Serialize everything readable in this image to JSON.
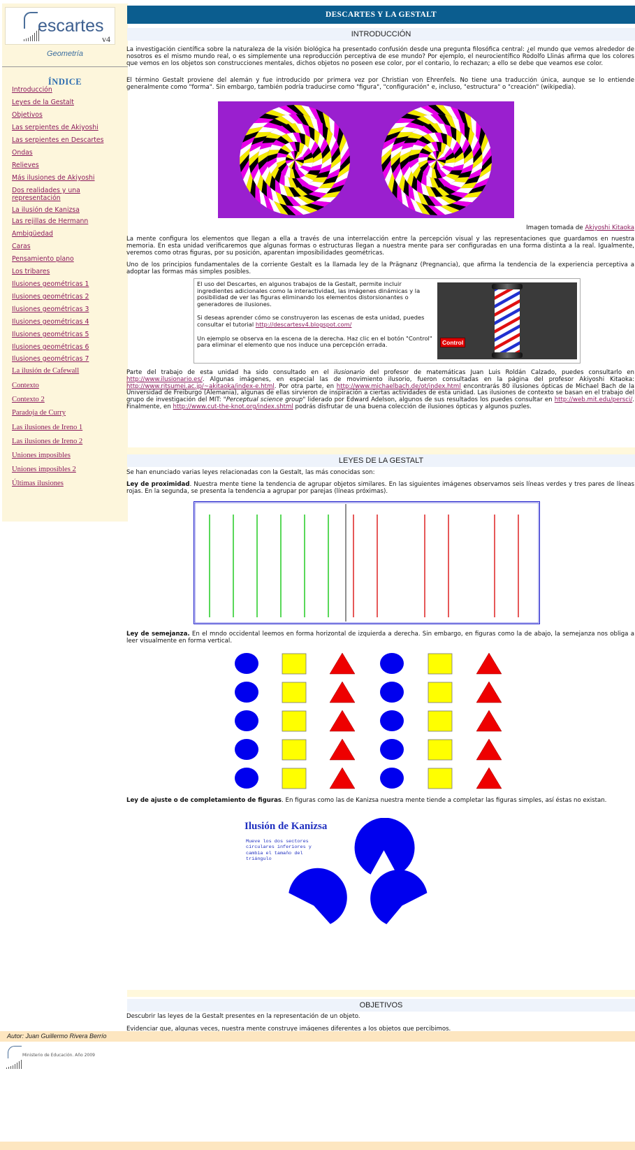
{
  "brand": {
    "logo_text": "escartes",
    "logo_initial": "D",
    "version": "v4",
    "subject": "Geometría"
  },
  "sidebar": {
    "index_title": "ÍNDICE",
    "items": [
      "Introducción",
      "Leyes de la Gestalt",
      "Objetivos",
      "Las serpientes de Akiyoshi",
      "Las serpientes en Descartes",
      "Ondas",
      "Relieves",
      "Más ilusiones de Akiyoshi",
      "Dos realidades y una representación",
      "La ilusión de Kanizsa",
      "Las rejillas de Hermann",
      "Ambigüedad",
      "Caras",
      "Pensamiento plano",
      "Los tribares",
      "Ilusiones geométricas 1",
      "Ilusiones geométricas 2",
      "Ilusiones geométricas 3",
      "Ilusiones geométricas 4",
      "Ilusiones geométricas 5",
      "Ilusiones geométricas 6",
      "Ilusiones geométricas 7",
      "La ilusión de Cafewall",
      "Contexto",
      "Contexto 2",
      "Paradoja de Curry",
      "Las ilusiones de Ireno 1",
      "Las ilusiones de Ireno 2",
      "Uniones imposibles",
      "Uniones imposibles 2",
      "Últimas ilusiones"
    ]
  },
  "page": {
    "title": "DESCARTES Y LA GESTALT",
    "intro": {
      "heading": "INTRODUCCIÓN",
      "p1": "La investigación científica sobre la naturaleza de la visión biológica ha presentado confusión desde una pregunta filosófica central: ¿el mundo que vemos alrededor de nosotros es el mismo mundo real, o es simplemente una reproducción perceptiva de ese mundo? Por ejemplo, el neurocientífico Rodolfo Llinás afirma que los colores que vemos en los objetos son construcciones mentales, dichos objetos no poseen ese color, por el contario, lo rechazan; a ello se debe que veamos ese color.",
      "p2": "El término Gestalt proviene del alemán y fue introducido por primera vez por Christian von Ehrenfels. No tiene una traducción única, aunque se lo entiende generalmente como \"forma\". Sin embargo, también podría traducirse como \"figura\", \"configuración\" e, incluso, \"estructura\" o \"creación\" (wikipedia).",
      "caption_text": "Imagen tomada de ",
      "caption_link": "Akiyoshi Kitaoka",
      "p3": "La mente configura los elementos que llegan a ella a través de una interrelacción entre la percepción visual y las representaciones que guardamos en nuestra memoria. En esta unidad verificaremos que algunas formas o estructuras llegan a nuestra mente para ser configuradas en una forma distinta a la real. Igualmente, veremos como otras figuras, por su posición, aparentan imposibilidades geométricas.",
      "p4": "Uno de los principios fundamentales de la corriente Gestalt es la llamada ley de la Prägnanz (Pregnancia), que afirma la tendencia de la experiencia perceptiva a adoptar las formas más simples posibles.",
      "box_p1": "El uso del Descartes, en algunos trabajos de la Gestalt, permite incluir ingredientes adicionales como la interactividad, las imágenes dinámicas y la posibilidad de ver las figuras eliminando los elementos distorsionantes o generadores de ilusiones.",
      "box_p2_text": "Si deseas aprender cómo se construyeron las escenas de esta unidad, puedes consultar el tutorial ",
      "box_p2_link": "http://descartesv4.blogspot.com/",
      "box_p3": "Un ejemplo se observa en la escena de la derecha. Haz clic en el botón \"Control\" para eliminar el elemento que nos induce una percepción errada.",
      "control_label": "Control",
      "p5_a": "Parte del trabajo de esta unidad ha sido consultado en el ",
      "p5_b": "ilusionario",
      "p5_c": " del profesor de matemáticas Juan Luis Roldán Calzado, puedes consultarlo en ",
      "link1": "http://www.ilusionario.es/",
      "p5_d": ". Algunas imágenes, en especial las de movimiento ilusorio, fueron consultadas en la página del profesor Akiyoshi Kitaoka: ",
      "link2": "http://www.ritsumei.ac.jp/~akitaoka/index-e.html",
      "p5_e": ". Por otra parte, en ",
      "link3": "http://www.michaelbach.de/ot/index.html",
      "p5_f": " encontrarás 80 ilusiones ópticas de Michael Bach de la Universidad de Freiburgo (Alemania), algunas de ellas sirvieron de inspiración a ciertas actividades de esta unidad. Las ilusiones de contexto se basan en el trabajo del grupo de investigación del MIT: \"",
      "p5_g": "Perceptual science group",
      "p5_h": "\" liderado por Edward Adelson, algunos de sus resultados los puedes consultar en ",
      "link4": "http://web.mit.edu/persci/",
      "p5_i": ". Finalmente, en ",
      "link5": "http://www.cut-the-knot.org/index.shtml",
      "p5_j": " podrás disfrutar de una buena colección de ilusiones ópticas y algunos puzles."
    },
    "laws": {
      "heading": "LEYES DE LA GESTALT",
      "lead": "Se han enunciado varias leyes relacionadas con la Gestalt, las más conocidas son:",
      "prox_title": "Ley de proximidad",
      "prox_text": ". Nuestra mente tiene la tendencia de agrupar objetos similares. En las siguientes imágenes observamos seis líneas verdes y tres pares de líneas rojas. En la segunda, se presenta la tendencia a agrupar por parejas (líneas próximas).",
      "sim_title": "Ley de semejanza.",
      "sim_text": " En el mndo occidental leemos en forma horizontal de izquierda a derecha. Sin embargo, en figuras como la de abajo, la semejanza nos obliga a leer visualmente en forma vertical.",
      "closure_title": "Ley de ajuste o de completamiento de figuras",
      "closure_text": ". En figuras como las de Kanizsa nuestra mente tiende a completar las figuras simples, así éstas no existan.",
      "kanizsa_title": "Ilusión de Kanizsa",
      "kanizsa_desc": "Mueve los dos sectores circulares inferiores y cambia el tamaño del triángulo"
    },
    "objectives": {
      "heading": "OBJETIVOS",
      "o1": "Descubrir las leyes de la Gestalt presentes en la representación de un objeto.",
      "o2": "Evidenciar que, algunas veces, nuestra mente construye imágenes diferentes a los objetos que percibimos."
    }
  },
  "footer": {
    "author": "Autor: Juan Guillermo Rivera Berrío",
    "ministry": "Ministerio de Educación. Año 2009"
  },
  "colors": {
    "header_blue": "#0b5d8f",
    "sidebar_bg": "#fdf6dc",
    "link": "#8b1a5c",
    "illusion_bg": "#9a1fcf"
  }
}
